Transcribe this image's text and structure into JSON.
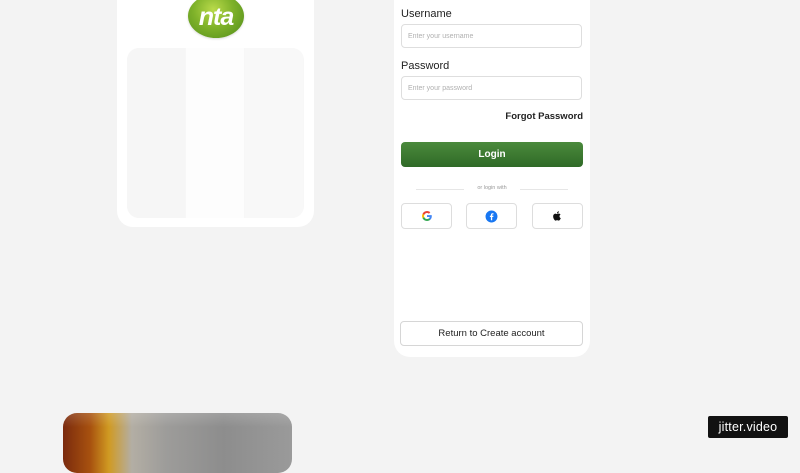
{
  "logo": {
    "text": "nta"
  },
  "login": {
    "username_label": "Username",
    "username_placeholder": "Enter your username",
    "password_label": "Password",
    "password_placeholder": "Enter your password",
    "forgot_label": "Forgot Password",
    "login_label": "Login",
    "or_text": "or login with",
    "social": [
      "google-icon",
      "facebook-icon",
      "apple-icon"
    ],
    "create_label": "Return to Create account"
  },
  "watermark": {
    "text": "jitter.video"
  },
  "colors": {
    "primary_green": "#3a7a30",
    "background": "#f3f3f3",
    "card": "#ffffff",
    "google_blue": "#4285F4",
    "google_red": "#EA4335",
    "google_yellow": "#FBBC05",
    "google_green": "#34A853",
    "facebook_blue": "#1877F2"
  }
}
